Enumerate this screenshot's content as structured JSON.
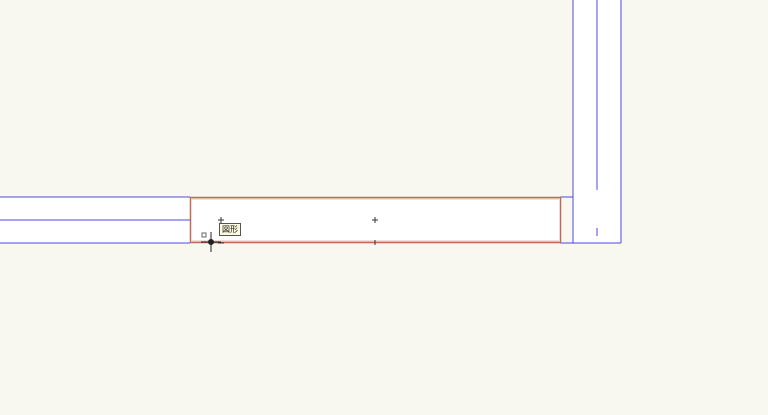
{
  "app": {
    "canvas_background": "#f8f7f0",
    "wall_color": "#4a4ae0",
    "selection_color": "#c06a55",
    "crosshair_color": "#222222"
  },
  "cursor_tooltip": {
    "label": "図形",
    "icon": "crosshair-cursor-icon"
  }
}
